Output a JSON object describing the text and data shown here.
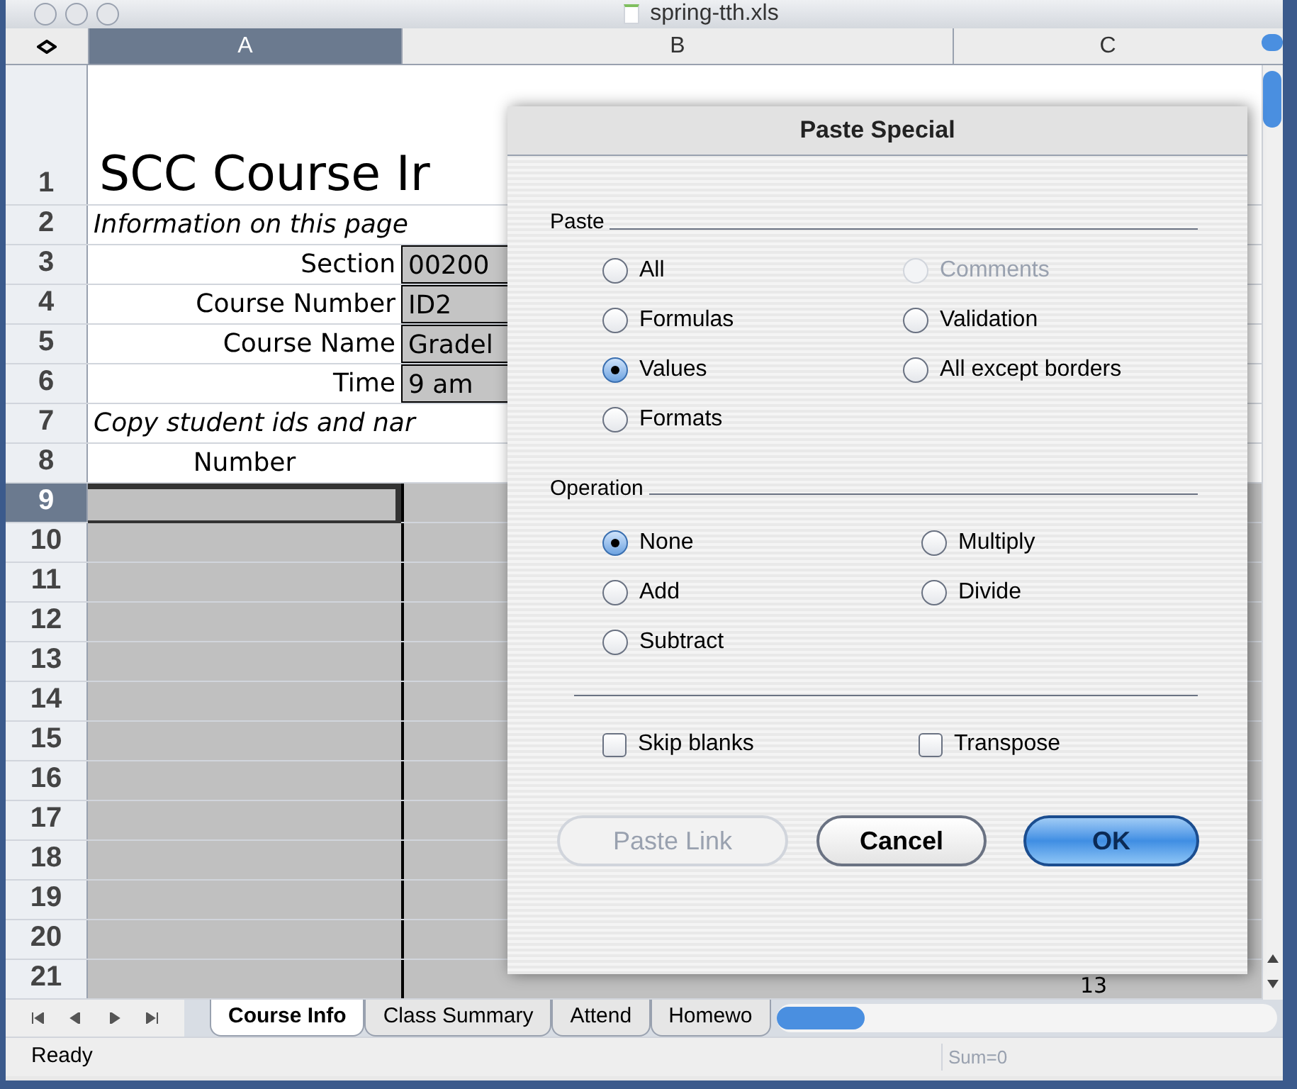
{
  "window": {
    "title": "spring-tth.xls"
  },
  "columns": [
    {
      "label": "A",
      "selected": true
    },
    {
      "label": "B",
      "selected": false
    },
    {
      "label": "C",
      "selected": false
    }
  ],
  "rows": [
    {
      "label": "1",
      "selected": false,
      "shaded": false,
      "cells": [
        {
          "kind": "title",
          "text": "SCC Course Ir"
        }
      ]
    },
    {
      "label": "2",
      "selected": false,
      "shaded": false,
      "cells": [
        {
          "kind": "note",
          "text": "Information on this page"
        }
      ]
    },
    {
      "label": "3",
      "selected": false,
      "shaded": false,
      "cells": [
        {
          "kind": "label",
          "text": "Section"
        },
        {
          "kind": "input",
          "text": "00200"
        }
      ]
    },
    {
      "label": "4",
      "selected": false,
      "shaded": false,
      "cells": [
        {
          "kind": "label",
          "text": "Course Number"
        },
        {
          "kind": "input",
          "text": "ID2"
        }
      ]
    },
    {
      "label": "5",
      "selected": false,
      "shaded": false,
      "cells": [
        {
          "kind": "label",
          "text": "Course Name"
        },
        {
          "kind": "input",
          "text": "Gradel"
        }
      ]
    },
    {
      "label": "6",
      "selected": false,
      "shaded": false,
      "cells": [
        {
          "kind": "label",
          "text": "Time"
        },
        {
          "kind": "input",
          "text": "9 am"
        }
      ]
    },
    {
      "label": "7",
      "selected": false,
      "shaded": false,
      "cells": [
        {
          "kind": "note",
          "text": "Copy student ids and nar"
        }
      ]
    },
    {
      "label": "8",
      "selected": false,
      "shaded": false,
      "cells": [
        {
          "kind": "header",
          "text": "Number"
        }
      ]
    },
    {
      "label": "9",
      "selected": true,
      "shaded": true,
      "cells": []
    },
    {
      "label": "10",
      "selected": false,
      "shaded": true,
      "cells": []
    },
    {
      "label": "11",
      "selected": false,
      "shaded": true,
      "cells": []
    },
    {
      "label": "12",
      "selected": false,
      "shaded": true,
      "cells": []
    },
    {
      "label": "13",
      "selected": false,
      "shaded": true,
      "cells": []
    },
    {
      "label": "14",
      "selected": false,
      "shaded": true,
      "cells": []
    },
    {
      "label": "15",
      "selected": false,
      "shaded": true,
      "cells": []
    },
    {
      "label": "16",
      "selected": false,
      "shaded": true,
      "cells": []
    },
    {
      "label": "17",
      "selected": false,
      "shaded": true,
      "cells": []
    },
    {
      "label": "18",
      "selected": false,
      "shaded": true,
      "cells": []
    },
    {
      "label": "19",
      "selected": false,
      "shaded": true,
      "cells": []
    },
    {
      "label": "20",
      "selected": false,
      "shaded": true,
      "cells": []
    },
    {
      "label": "21",
      "selected": false,
      "shaded": true,
      "cells": [
        {
          "kind": "number",
          "text": "13"
        }
      ]
    }
  ],
  "sheet_tabs": [
    {
      "label": "Course Info",
      "selected": true
    },
    {
      "label": "Class Summary",
      "selected": false
    },
    {
      "label": "Attend",
      "selected": false
    },
    {
      "label": "Homewo",
      "selected": false
    }
  ],
  "status_bar": {
    "status": "Ready",
    "sum": "Sum=0"
  },
  "dialog": {
    "title": "Paste Special",
    "paste": {
      "label": "Paste",
      "options": [
        {
          "label": "All",
          "selected": false,
          "disabled": false
        },
        {
          "label": "Formulas",
          "selected": false,
          "disabled": false
        },
        {
          "label": "Values",
          "selected": true,
          "disabled": false
        },
        {
          "label": "Formats",
          "selected": false,
          "disabled": false
        },
        {
          "label": "Comments",
          "selected": false,
          "disabled": true
        },
        {
          "label": "Validation",
          "selected": false,
          "disabled": false
        },
        {
          "label": "All except borders",
          "selected": false,
          "disabled": false
        }
      ]
    },
    "operation": {
      "label": "Operation",
      "options": [
        {
          "label": "None",
          "selected": true
        },
        {
          "label": "Add",
          "selected": false
        },
        {
          "label": "Subtract",
          "selected": false
        },
        {
          "label": "Multiply",
          "selected": false
        },
        {
          "label": "Divide",
          "selected": false
        }
      ]
    },
    "checkboxes": [
      {
        "label": "Skip blanks",
        "checked": false
      },
      {
        "label": "Transpose",
        "checked": false
      }
    ],
    "buttons": [
      {
        "label": "Paste Link",
        "kind": "disabled"
      },
      {
        "label": "Cancel",
        "kind": "normal"
      },
      {
        "label": "OK",
        "kind": "default"
      }
    ]
  }
}
